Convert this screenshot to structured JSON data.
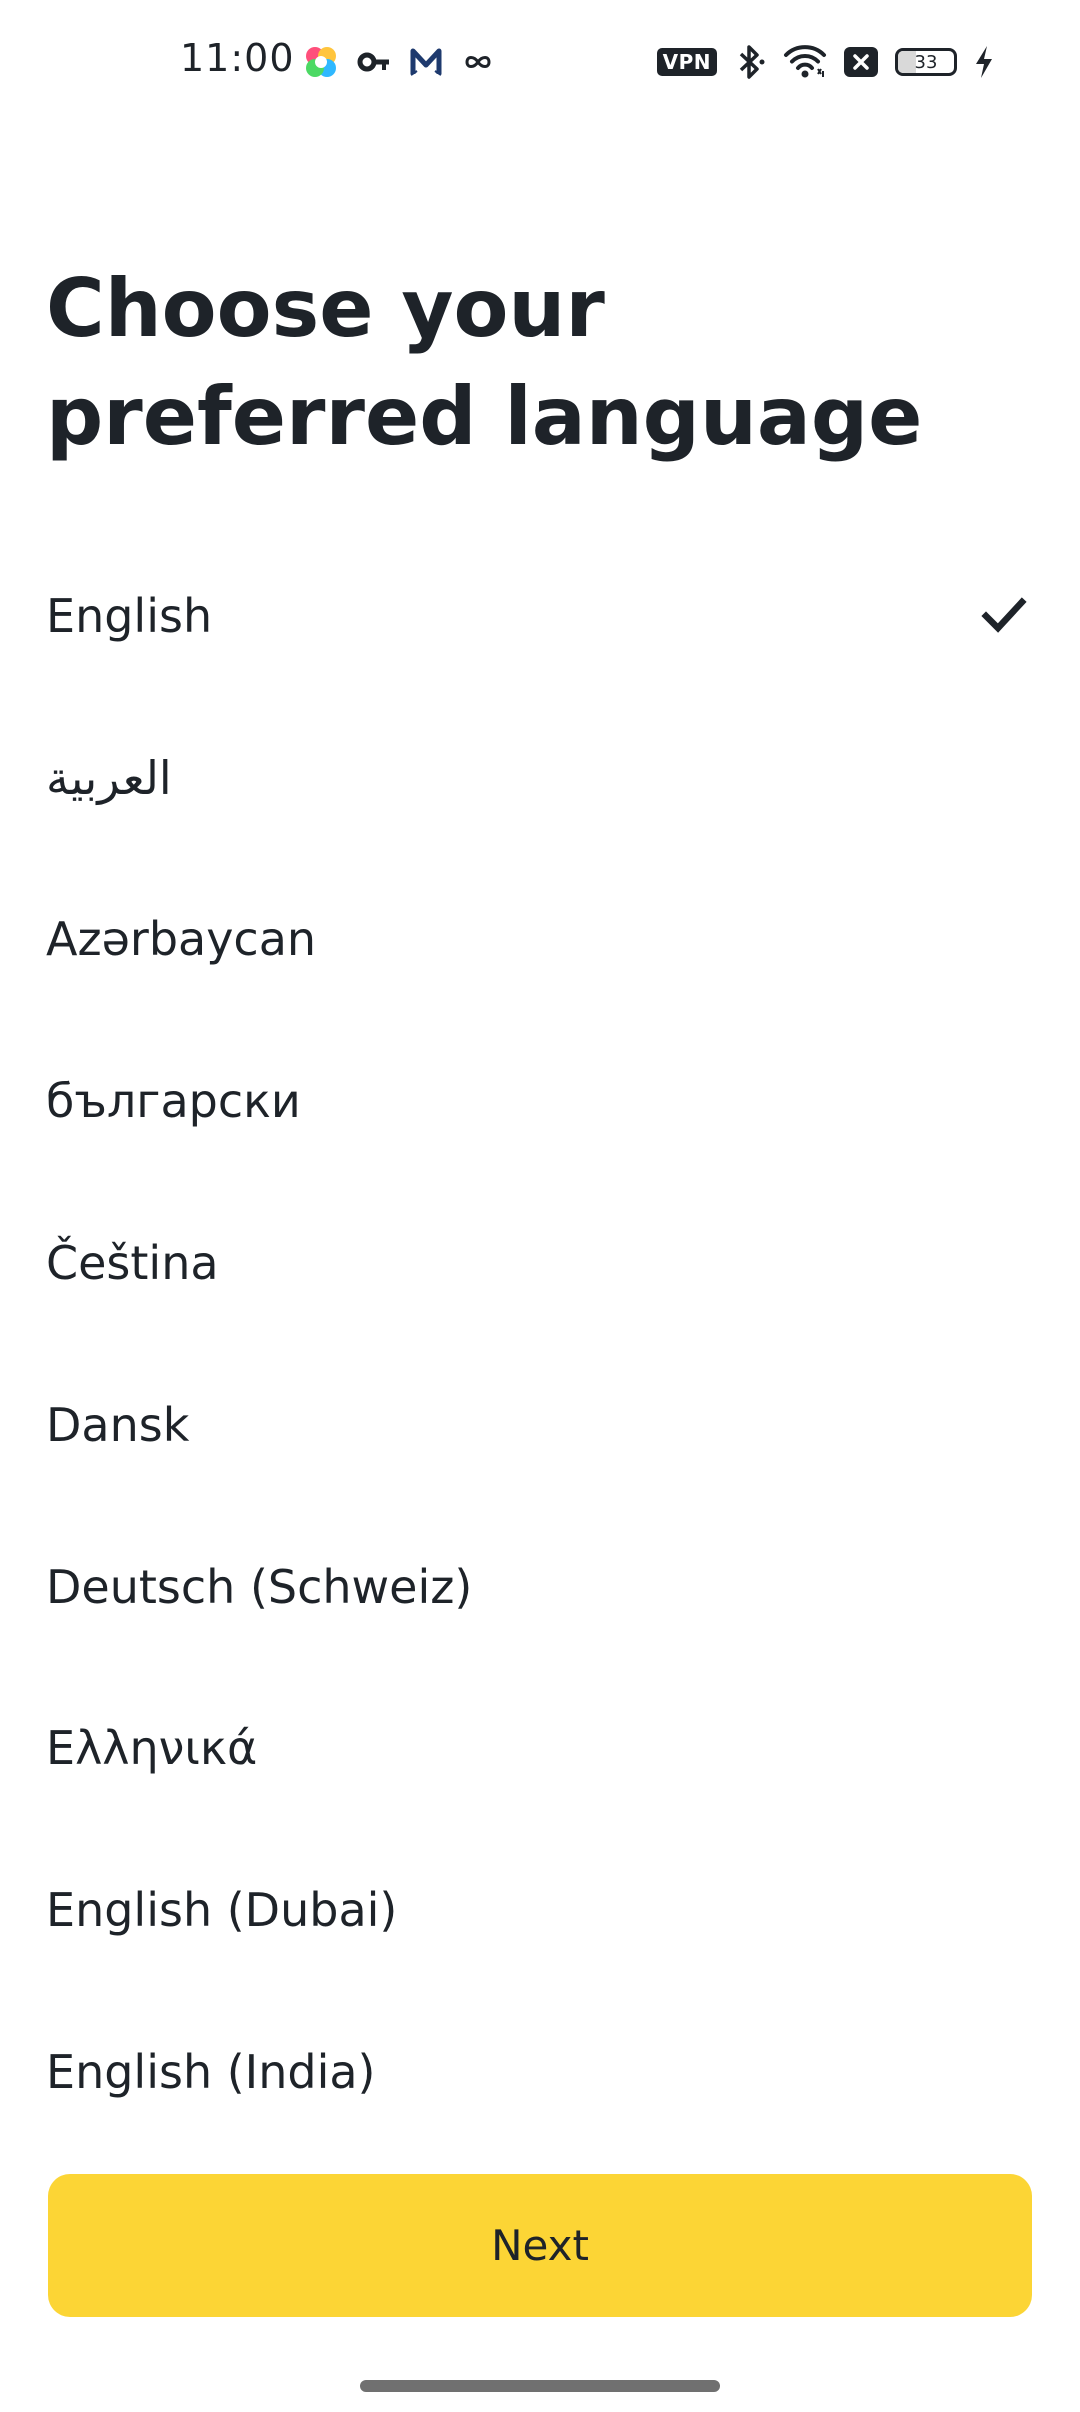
{
  "status_bar": {
    "time": "11:00",
    "left_icons": [
      "pinwheel-app-icon",
      "key-icon",
      "mail-icon",
      "infinity-icon"
    ],
    "right_icons": [
      "vpn-icon",
      "bluetooth-icon",
      "wifi-icon",
      "sim-off-icon",
      "battery-icon",
      "charging-icon"
    ],
    "vpn_label": "VPN",
    "battery_level": "33"
  },
  "page": {
    "title": "Choose your preferred language"
  },
  "languages": {
    "selected": "English",
    "items": [
      {
        "label": "English",
        "selected": true
      },
      {
        "label": "العربية",
        "selected": false
      },
      {
        "label": "Azərbaycan",
        "selected": false
      },
      {
        "label": "български",
        "selected": false
      },
      {
        "label": "Čeština",
        "selected": false
      },
      {
        "label": "Dansk",
        "selected": false
      },
      {
        "label": "Deutsch (Schweiz)",
        "selected": false
      },
      {
        "label": "Ελληνικά",
        "selected": false
      },
      {
        "label": "English (Dubai)",
        "selected": false
      },
      {
        "label": "English (India)",
        "selected": false
      }
    ]
  },
  "footer": {
    "next_label": "Next"
  },
  "colors": {
    "accent": "#fcd535",
    "text": "#1e2329",
    "background": "#ffffff"
  }
}
